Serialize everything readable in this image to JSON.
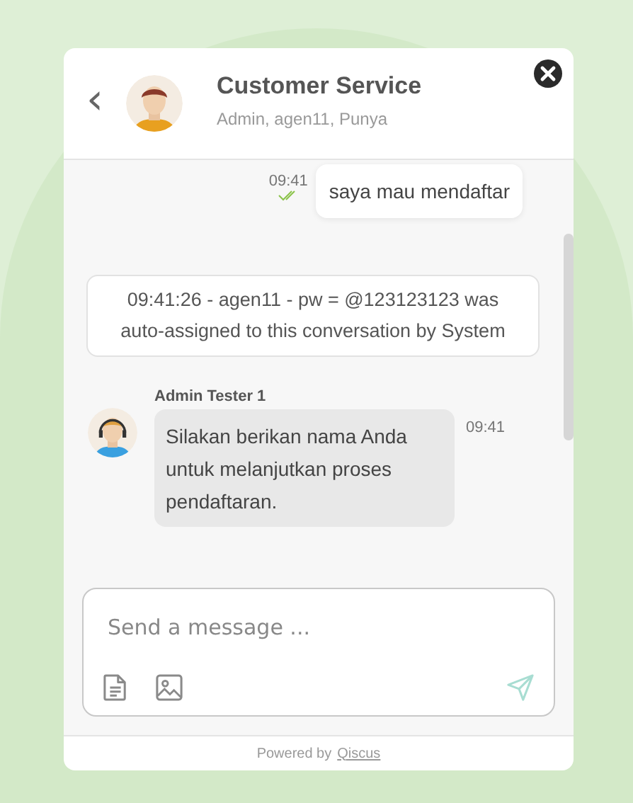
{
  "header": {
    "back": "‹",
    "title": "Customer Service",
    "subtitle": "Admin, agen11, Punya"
  },
  "messages": [
    {
      "kind": "outgoing",
      "text": "saya mau mendaftar",
      "time": "09:41",
      "read": true
    },
    {
      "kind": "system",
      "text": "09:41:26 - agen11 - pw = @123123123 was auto-assigned to this conversation by System"
    },
    {
      "kind": "incoming",
      "sender": "Admin Tester 1",
      "text": "Silakan berikan nama Anda untuk melanjutkan proses pendaftaran.",
      "time": "09:41"
    }
  ],
  "composer": {
    "placeholder": "Send a message ..."
  },
  "footer": {
    "prefix": "Powered by",
    "link": "Qiscus"
  }
}
